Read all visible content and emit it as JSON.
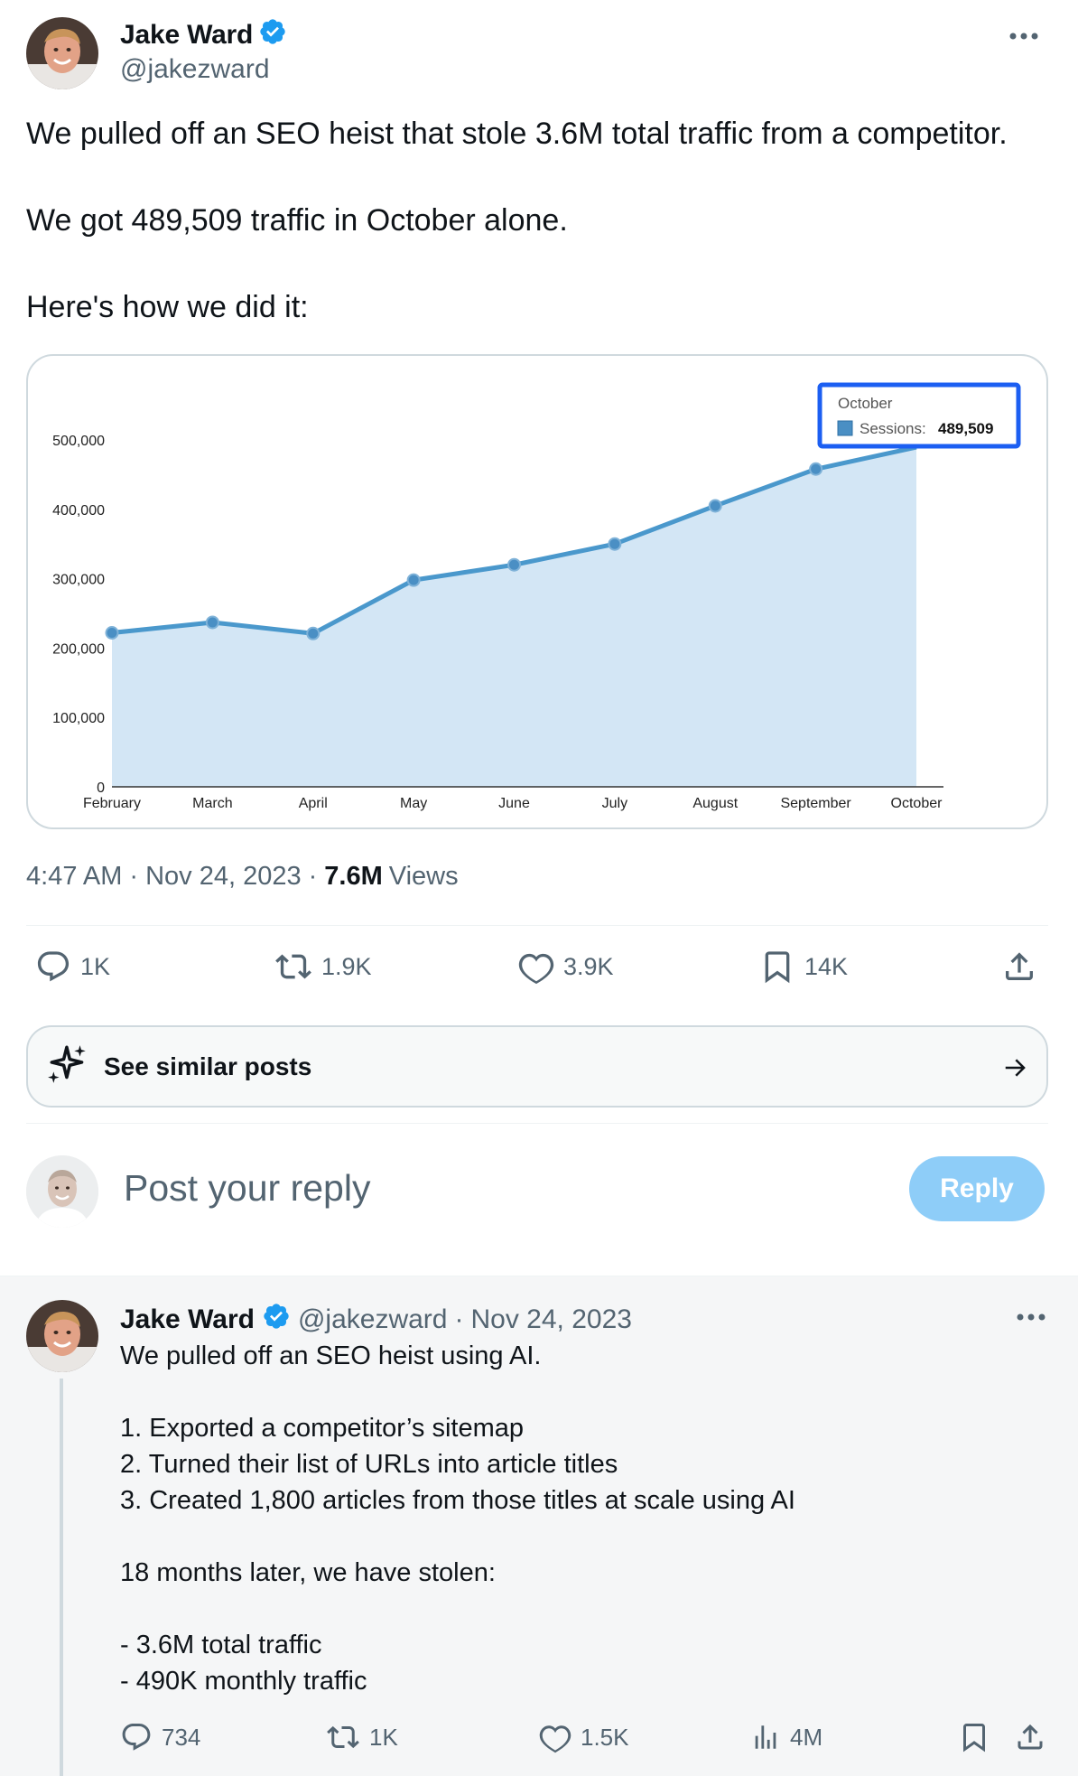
{
  "post": {
    "author": {
      "name": "Jake Ward",
      "handle": "@jakezward"
    },
    "text": "We pulled off an SEO heist that stole 3.6M total traffic from a competitor.\n\nWe got 489,509 traffic in October alone.\n\nHere's how we did it:",
    "time": "4:47 AM",
    "date": "Nov 24, 2023",
    "views_count": "7.6M",
    "views_label": "Views",
    "separator": "·",
    "actions": {
      "replies": "1K",
      "reposts": "1.9K",
      "likes": "3.9K",
      "bookmarks": "14K"
    }
  },
  "chart_data": {
    "type": "area",
    "categories": [
      "February",
      "March",
      "April",
      "May",
      "June",
      "July",
      "August",
      "September",
      "October"
    ],
    "series": [
      {
        "name": "Sessions",
        "values": [
          222000,
          237000,
          221000,
          298000,
          320000,
          350000,
          405000,
          458000,
          489509
        ]
      }
    ],
    "ylim": [
      0,
      500000
    ],
    "yticks": [
      "0",
      "100,000",
      "200,000",
      "300,000",
      "400,000",
      "500,000"
    ],
    "tooltip": {
      "title": "October",
      "label": "Sessions:",
      "value": "489,509"
    },
    "grid": false,
    "colors": {
      "line": "#4a98cc",
      "fill": "#d3e6f5",
      "tooltip_border": "#1c5ff2",
      "swatch": "#4a8fc4"
    }
  },
  "similar": {
    "label": "See similar posts"
  },
  "compose": {
    "placeholder": "Post your reply",
    "button": "Reply"
  },
  "reply": {
    "author": {
      "name": "Jake Ward",
      "handle": "@jakezward"
    },
    "separator": "·",
    "date": "Nov 24, 2023",
    "text": "We pulled off an SEO heist using AI.\n\n1. Exported a competitor’s sitemap\n2. Turned their list of URLs into article titles\n3. Created 1,800 articles from those titles at scale using AI\n\n18 months later, we have stolen:\n\n- 3.6M total traffic\n- 490K monthly traffic",
    "actions": {
      "replies": "734",
      "reposts": "1K",
      "likes": "1.5K",
      "views": "4M"
    }
  },
  "colors": {
    "verified": "#1d9bf0",
    "muted": "#536471",
    "reply_button": "#8ecdf8"
  },
  "icons": [
    "verified-badge-icon",
    "more-icon",
    "reply-icon",
    "repost-icon",
    "like-icon",
    "bookmark-icon",
    "share-icon",
    "sparkle-icon",
    "arrow-right-icon",
    "views-icon"
  ]
}
